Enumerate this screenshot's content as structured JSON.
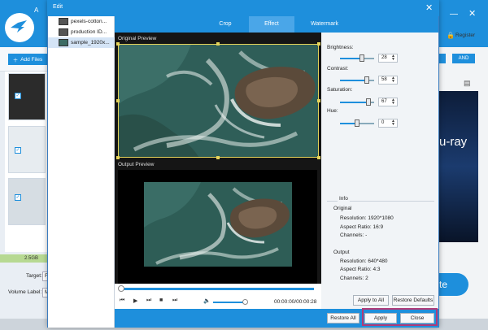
{
  "background_app": {
    "title_letter": "A",
    "add_files_label": "Add Files",
    "register_label": "Register",
    "and_label": "AND",
    "disc_text": "u-ray",
    "size_label": "2.5GB",
    "target_label": "Target:",
    "target_value": "F",
    "volume_label": "Volume Label:",
    "volume_value": "M",
    "start_label": "te",
    "checkmark": "✓"
  },
  "dialog": {
    "title": "Edit",
    "close_glyph": "✕"
  },
  "files": [
    {
      "name": "pexels-cotton..."
    },
    {
      "name": "production ID..."
    },
    {
      "name": "sample_1920x..."
    }
  ],
  "tabs": [
    {
      "label": "Crop"
    },
    {
      "label": "Effect"
    },
    {
      "label": "Watermark"
    }
  ],
  "active_tab": "Effect",
  "preview": {
    "original_label": "Original Preview",
    "output_label": "Output Preview",
    "timecode": "00:00:00/00:00:28",
    "seek_fraction": 0.0,
    "volume_fraction": 0.9
  },
  "adjustments": [
    {
      "label": "Brightness:",
      "value": "28",
      "fraction": 0.64
    },
    {
      "label": "Contrast:",
      "value": "58",
      "fraction": 0.79
    },
    {
      "label": "Saturation:",
      "value": "67",
      "fraction": 0.83
    },
    {
      "label": "Hue:",
      "value": "0",
      "fraction": 0.5
    }
  ],
  "info": {
    "heading": "Info",
    "original_heading": "Original",
    "original_resolution": "Resolution: 1920*1080",
    "original_aspect": "Aspect Ratio: 16:9",
    "original_channels": "Channels: -",
    "output_heading": "Output",
    "output_resolution": "Resolution: 640*480",
    "output_aspect": "Aspect Ratio: 4:3",
    "output_channels": "Channels: 2"
  },
  "buttons": {
    "apply_to_all": "Apply to All",
    "restore_defaults": "Restore Defaults",
    "restore_all": "Restore All",
    "apply": "Apply",
    "close": "Close"
  },
  "colors": {
    "accent": "#1e8fdc",
    "highlight": "#b03a78",
    "crop_frame": "#e5d35a"
  }
}
